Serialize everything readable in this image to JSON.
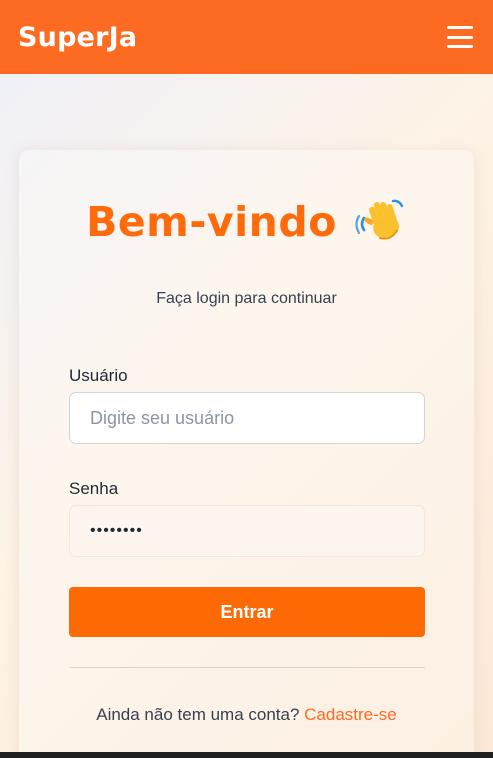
{
  "navbar": {
    "brand": "SuperJa",
    "menu_icon": "hamburger-menu-icon",
    "background": "#fd6b22"
  },
  "login": {
    "title": "Bem-vindo",
    "title_icon": "waving-hand-icon",
    "subtitle": "Faça login para continuar",
    "username": {
      "label": "Usuário",
      "placeholder": "Digite seu usuário",
      "value": ""
    },
    "password": {
      "label": "Senha",
      "value": "12345678"
    },
    "submit_label": "Entrar",
    "signup_prompt": "Ainda não tem uma conta?",
    "signup_link": "Cadastre-se"
  },
  "colors": {
    "accent": "#fd6905",
    "title": "#ff6a0b"
  }
}
